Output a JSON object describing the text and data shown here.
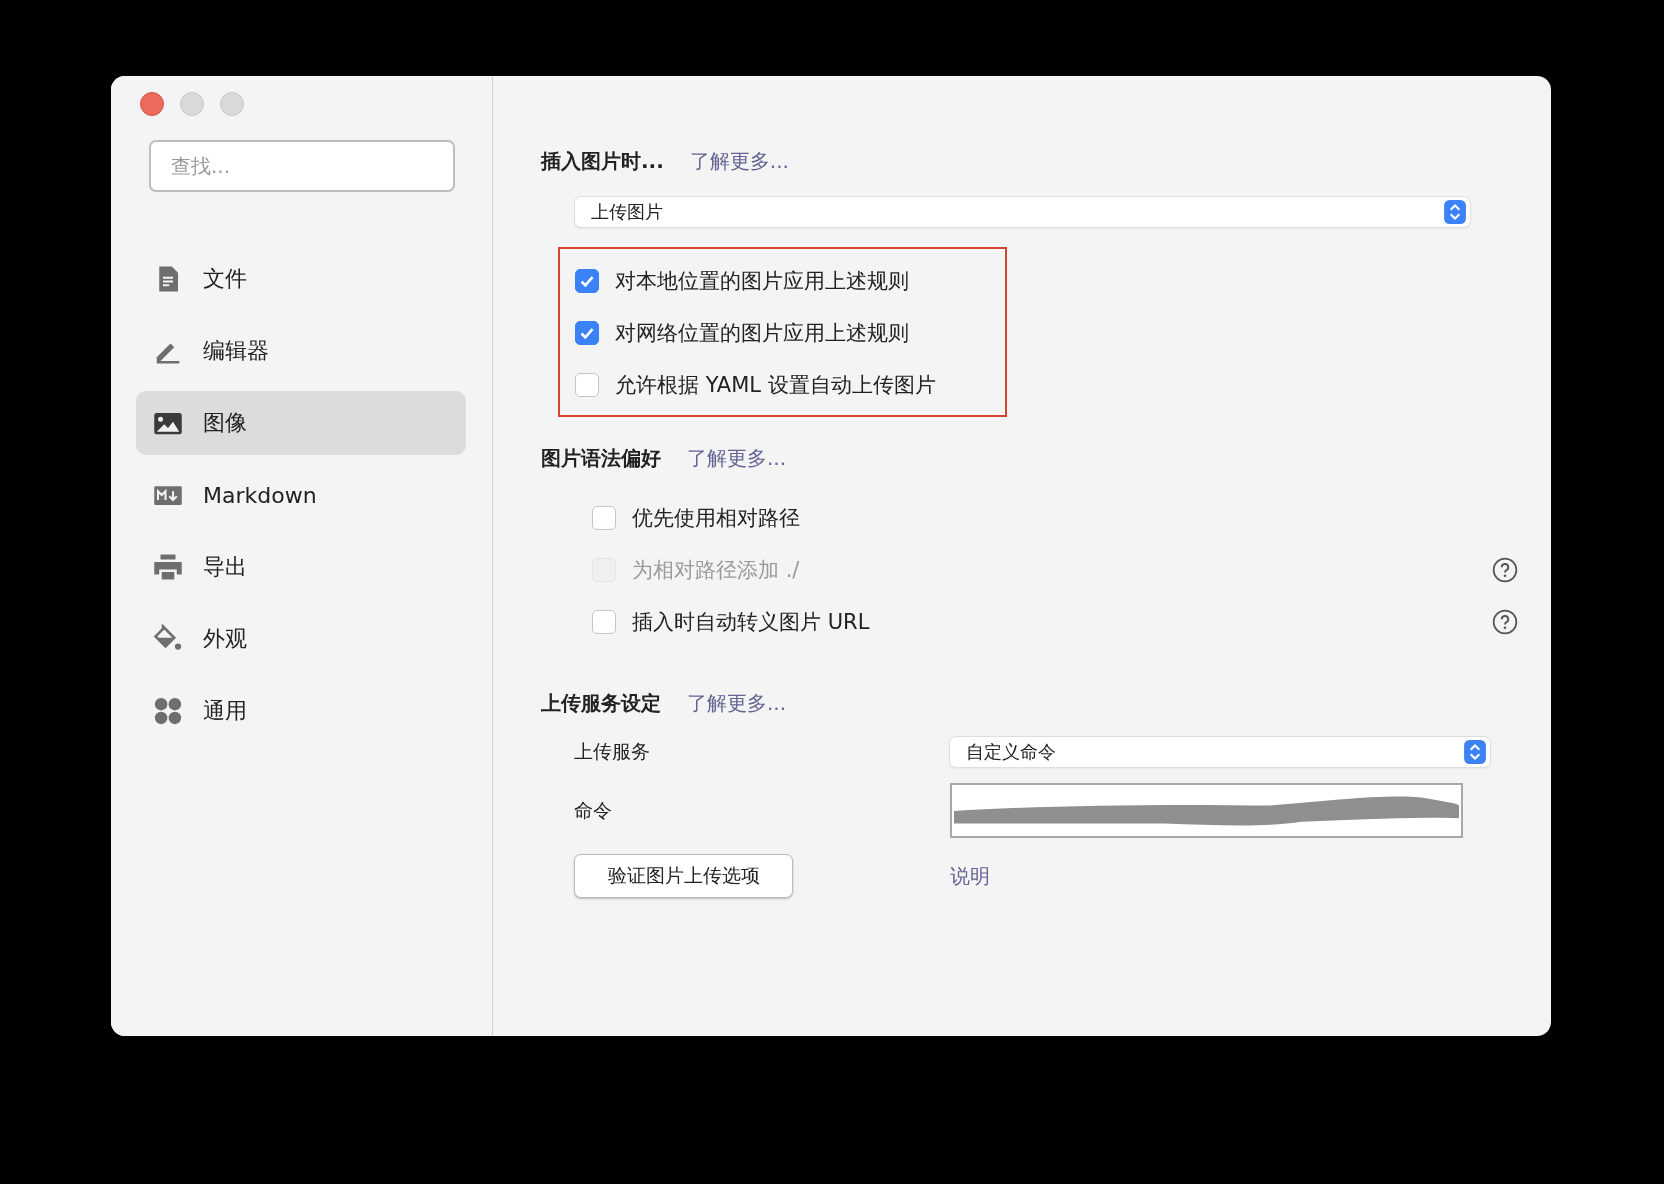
{
  "sidebar": {
    "search": {
      "placeholder": "查找..."
    },
    "items": [
      {
        "label": "文件",
        "selected": false
      },
      {
        "label": "编辑器",
        "selected": false
      },
      {
        "label": "图像",
        "selected": true
      },
      {
        "label": "Markdown",
        "selected": false
      },
      {
        "label": "导出",
        "selected": false
      },
      {
        "label": "外观",
        "selected": false
      },
      {
        "label": "通用",
        "selected": false
      }
    ]
  },
  "insert_section": {
    "title": "插入图片时...",
    "link": "了解更多...",
    "highlighted": true,
    "select": {
      "value": "上传图片"
    },
    "options": [
      {
        "label": "对本地位置的图片应用上述规则",
        "checked": true,
        "disabled": false,
        "help": false
      },
      {
        "label": "对网络位置的图片应用上述规则",
        "checked": true,
        "disabled": false,
        "help": false
      },
      {
        "label": "允许根据 YAML 设置自动上传图片",
        "checked": false,
        "disabled": false,
        "help": false
      }
    ]
  },
  "syntax_section": {
    "title": "图片语法偏好",
    "link": "了解更多...",
    "options": [
      {
        "label": "优先使用相对路径",
        "checked": false,
        "disabled": false,
        "help": false
      },
      {
        "label": "为相对路径添加 ./",
        "checked": false,
        "disabled": true,
        "help": true
      },
      {
        "label": "插入时自动转义图片 URL",
        "checked": false,
        "disabled": false,
        "help": true
      }
    ]
  },
  "upload_section": {
    "title": "上传服务设定",
    "link": "了解更多...",
    "service": {
      "label": "上传服务",
      "value": "自定义命令"
    },
    "command": {
      "label": "命令",
      "redacted": true
    },
    "button": "验证图片上传选项",
    "help_link": "说明"
  }
}
